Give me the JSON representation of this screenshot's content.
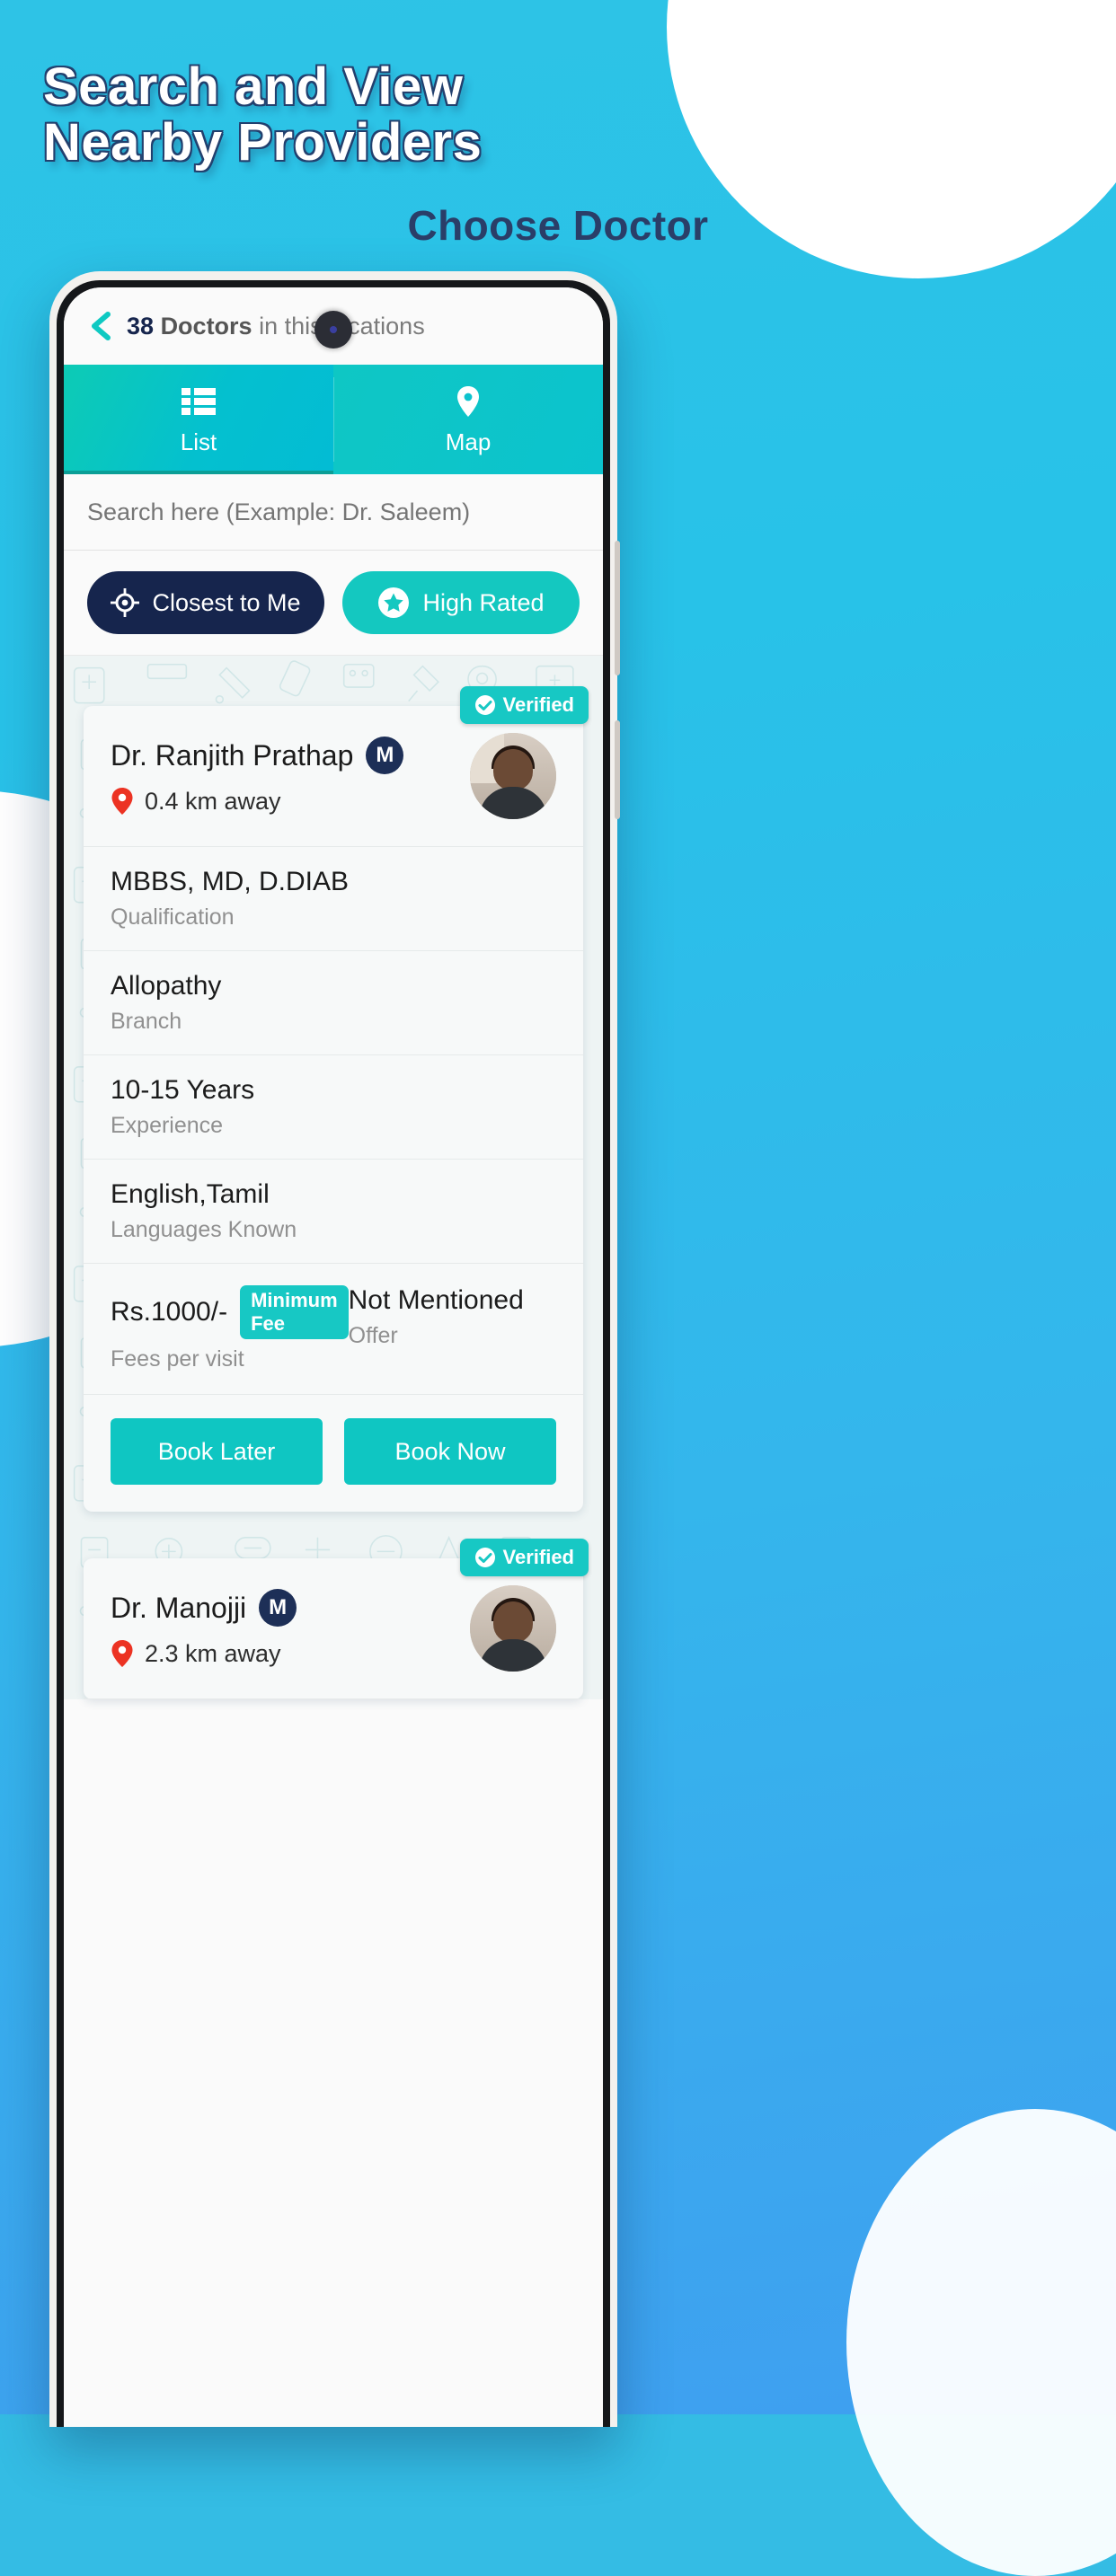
{
  "promo": {
    "headline_line1": "Search and View",
    "headline_line2": "Nearby Providers",
    "subtitle": "Choose Doctor"
  },
  "appbar": {
    "back_icon": "chevron-left-icon",
    "count": "38",
    "count_label": "Doctors",
    "rest": "in this locations"
  },
  "tabs": [
    {
      "label": "List",
      "icon": "list-icon",
      "active": true
    },
    {
      "label": "Map",
      "icon": "map-pin-icon",
      "active": false
    }
  ],
  "search": {
    "placeholder": "Search here (Example: Dr. Saleem)",
    "value": ""
  },
  "filters": [
    {
      "label": "Closest to Me",
      "icon": "crosshair-icon",
      "style": "dark"
    },
    {
      "label": "High Rated",
      "icon": "star-icon",
      "style": "teal"
    }
  ],
  "labels": {
    "verified": "Verified",
    "qualification": "Qualification",
    "branch": "Branch",
    "experience": "Experience",
    "languages": "Languages Known",
    "fees": "Fees per visit",
    "offer": "Offer",
    "minimum_fee": "Minimum Fee",
    "book_later": "Book Later",
    "book_now": "Book Now"
  },
  "colors": {
    "brand_teal": "#0fc6c2",
    "brand_navy": "#16254d",
    "page_blue": "#2ec3e6",
    "pin_red": "#ec3323"
  },
  "doctors": [
    {
      "name": "Dr. Ranjith Prathap",
      "gender": "M",
      "distance": "0.4 km away",
      "qualification": "MBBS, MD, D.DIAB",
      "branch": "Allopathy",
      "experience": "10-15 Years",
      "languages": "English,Tamil",
      "fee": "Rs.1000/-",
      "offer": "Not Mentioned",
      "verified": true
    },
    {
      "name": "Dr. Manojji",
      "gender": "M",
      "distance": "2.3 km away",
      "verified": true
    }
  ]
}
